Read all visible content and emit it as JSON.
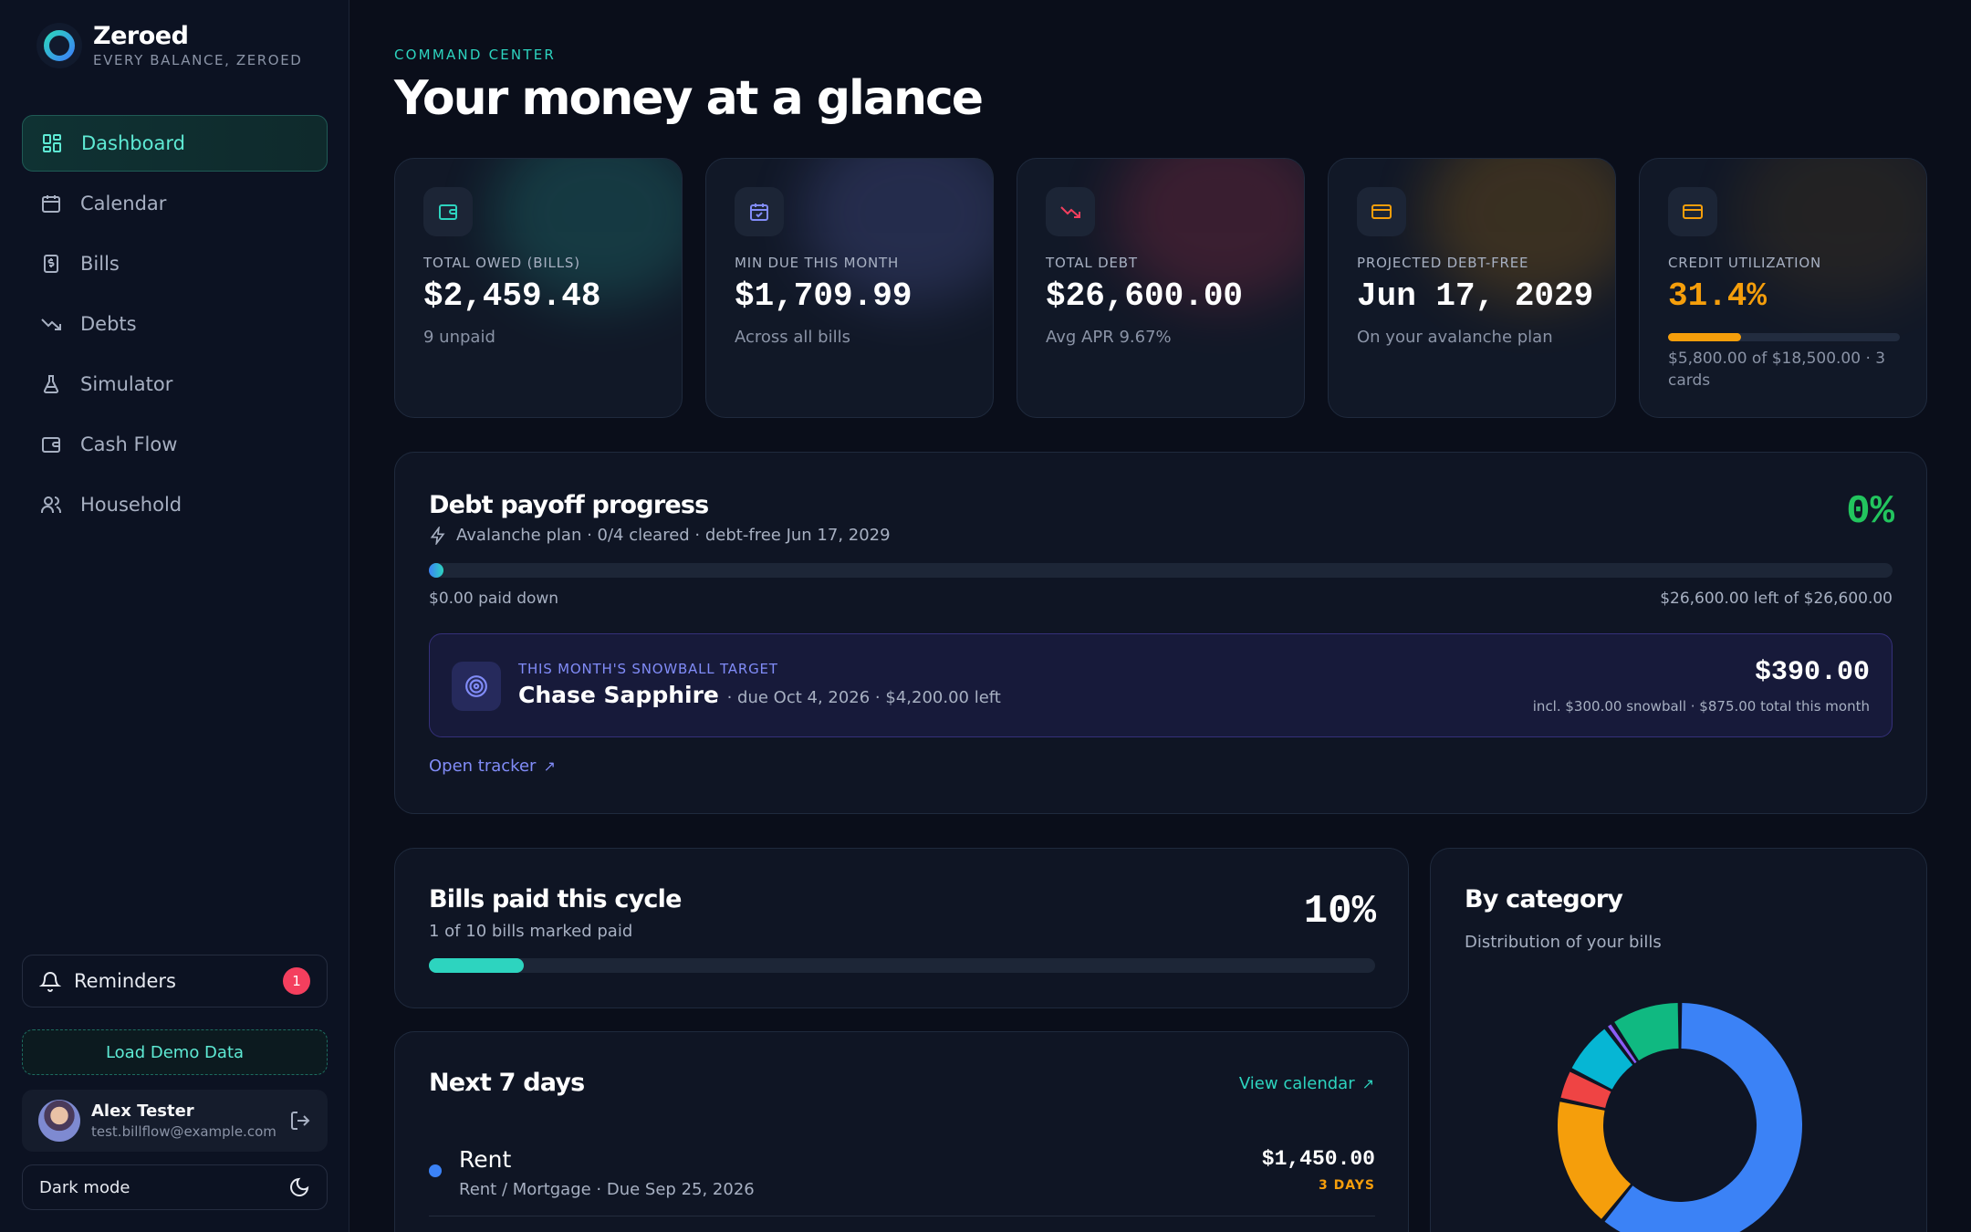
{
  "brand": {
    "name": "Zeroed",
    "tagline": "EVERY BALANCE, ZEROED"
  },
  "nav": [
    {
      "label": "Dashboard",
      "icon": "dashboard-icon",
      "active": true
    },
    {
      "label": "Calendar",
      "icon": "calendar-icon"
    },
    {
      "label": "Bills",
      "icon": "bills-icon"
    },
    {
      "label": "Debts",
      "icon": "trending-down-icon"
    },
    {
      "label": "Simulator",
      "icon": "flask-icon"
    },
    {
      "label": "Cash Flow",
      "icon": "wallet-icon"
    },
    {
      "label": "Household",
      "icon": "users-icon"
    }
  ],
  "reminders": {
    "label": "Reminders",
    "count": "1"
  },
  "demo": {
    "label": "Load Demo Data"
  },
  "user": {
    "name": "Alex Tester",
    "email": "test.billflow@example.com"
  },
  "theme": {
    "label": "Dark mode"
  },
  "header": {
    "eyebrow": "COMMAND CENTER",
    "title": "Your money at a glance"
  },
  "stats": [
    {
      "label": "TOTAL OWED (BILLS)",
      "value": "$2,459.48",
      "sub": "9 unpaid",
      "icon": "wallet-icon",
      "accent": "#2dd4bf"
    },
    {
      "label": "MIN DUE THIS MONTH",
      "value": "$1,709.99",
      "sub": "Across all bills",
      "icon": "calendar-check-icon",
      "accent": "#818cf8"
    },
    {
      "label": "TOTAL DEBT",
      "value": "$26,600.00",
      "sub": "Avg APR 9.67%",
      "icon": "trending-down-icon",
      "accent": "#f43f5e"
    },
    {
      "label": "PROJECTED DEBT-FREE",
      "value": "Jun 17, 2029",
      "sub": "On your avalanche plan",
      "icon": "credit-card-icon",
      "accent": "#f59e0b"
    },
    {
      "label": "CREDIT UTILIZATION",
      "value": "31.4%",
      "sub": "$5,800.00 of $18,500.00 · 3 cards",
      "icon": "credit-card-icon",
      "accent": "#f59e0b",
      "utilization": 0.314
    }
  ],
  "debt_progress": {
    "title": "Debt payoff progress",
    "subtitle": "Avalanche plan · 0/4 cleared · debt-free Jun 17, 2029",
    "percent": "0%",
    "paid_down": "$0.00 paid down",
    "remaining": "$26,600.00 left of $26,600.00",
    "snowball": {
      "eyebrow": "THIS MONTH'S SNOWBALL TARGET",
      "name": "Chase Sapphire",
      "detail": "· due Oct 4, 2026 · $4,200.00 left",
      "amount": "$390.00",
      "note": "incl. $300.00 snowball · $875.00 total this month"
    },
    "link": "Open tracker"
  },
  "bills_paid": {
    "title": "Bills paid this cycle",
    "subtitle": "1 of 10 bills marked paid",
    "percent": "10%",
    "fraction": 0.1
  },
  "next7": {
    "title": "Next 7 days",
    "link": "View calendar",
    "items": [
      {
        "name": "Rent",
        "meta": "Rent / Mortgage · Due Sep 25, 2026",
        "amount": "$1,450.00",
        "days": "3 DAYS",
        "color": "#3b82f6"
      }
    ]
  },
  "category": {
    "title": "By category",
    "subtitle": "Distribution of your bills",
    "chart_data": {
      "type": "pie",
      "style": "donut",
      "slice_colors": [
        "#3b82f6",
        "#f59e0b",
        "#ef4444",
        "#06b6d4",
        "#8b5cf6",
        "#10b981"
      ],
      "approx_shares": [
        0.59,
        0.17,
        0.04,
        0.07,
        0.01,
        0.09
      ]
    }
  }
}
